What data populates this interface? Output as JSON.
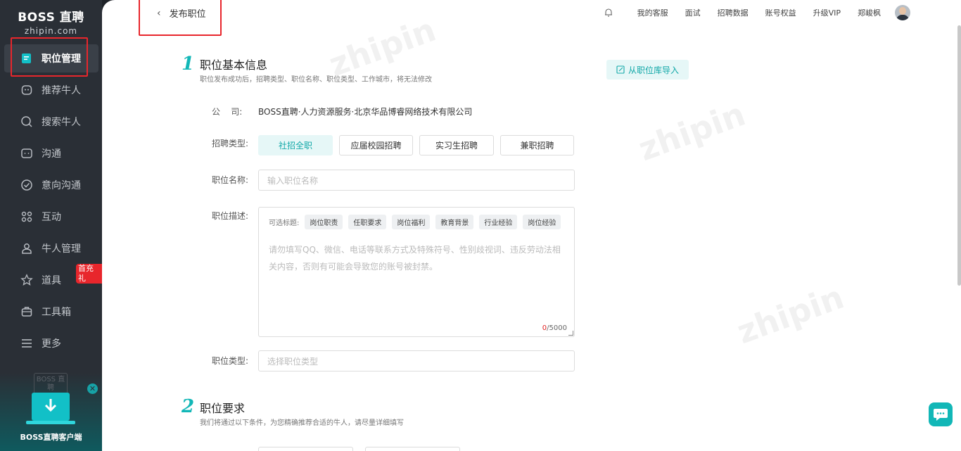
{
  "brand": {
    "line1": "BOSS 直聘",
    "line2": "zhipin.com"
  },
  "sidebar": {
    "items": [
      {
        "label": "职位管理",
        "icon": "job-icon",
        "active": true
      },
      {
        "label": "推荐牛人",
        "icon": "recommend-icon"
      },
      {
        "label": "搜索牛人",
        "icon": "search-icon"
      },
      {
        "label": "沟通",
        "icon": "chat-icon"
      },
      {
        "label": "意向沟通",
        "icon": "check-circle-icon"
      },
      {
        "label": "互动",
        "icon": "grid-icon"
      },
      {
        "label": "牛人管理",
        "icon": "person-icon"
      },
      {
        "label": "道具",
        "icon": "star-icon"
      },
      {
        "label": "工具箱",
        "icon": "toolbox-icon"
      },
      {
        "label": "更多",
        "icon": "menu-icon"
      }
    ],
    "props_badge": "首充礼",
    "client": {
      "label": "BOSS直聘客户端",
      "ghost_text": "BOSS 直聘",
      "close": "✕"
    }
  },
  "topbar": {
    "back_label": "发布职位",
    "links": [
      "我的客服",
      "面试",
      "招聘数据",
      "账号权益",
      "升级VIP",
      "郑峻枫"
    ]
  },
  "section1": {
    "number": "1",
    "title": "职位基本信息",
    "subtitle": "职位发布成功后，招聘类型、职位名称、职位类型、工作城市，将无法修改",
    "import_label": "从职位库导入",
    "company_label": "公    司:",
    "company_value": "BOSS直聘·人力资源服务·北京华品博睿网络技术有限公司",
    "type_label": "招聘类型:",
    "types": [
      "社招全职",
      "应届校园招聘",
      "实习生招聘",
      "兼职招聘"
    ],
    "name_label": "职位名称:",
    "name_placeholder": "输入职位名称",
    "desc_label": "职位描述:",
    "desc_tags_label": "可选标题:",
    "desc_tags": [
      "岗位职责",
      "任职要求",
      "岗位福利",
      "教育背景",
      "行业经验",
      "岗位经验"
    ],
    "desc_placeholder": "请勿填写QQ、微信、电话等联系方式及特殊符号、性别歧视词、违反劳动法相关内容，否则有可能会导致您的账号被封禁。",
    "desc_count": "0",
    "desc_max": "/5000",
    "category_label": "职位类型:",
    "category_placeholder": "选择职位类型"
  },
  "section2": {
    "number": "2",
    "title": "职位要求",
    "subtitle": "我们将通过以下条件，为您精确推荐合适的牛人，请尽量详细填写"
  },
  "colors": {
    "accent": "#12b7b7",
    "highlight": "#e8262c",
    "sidebar": "#2a2f36"
  }
}
